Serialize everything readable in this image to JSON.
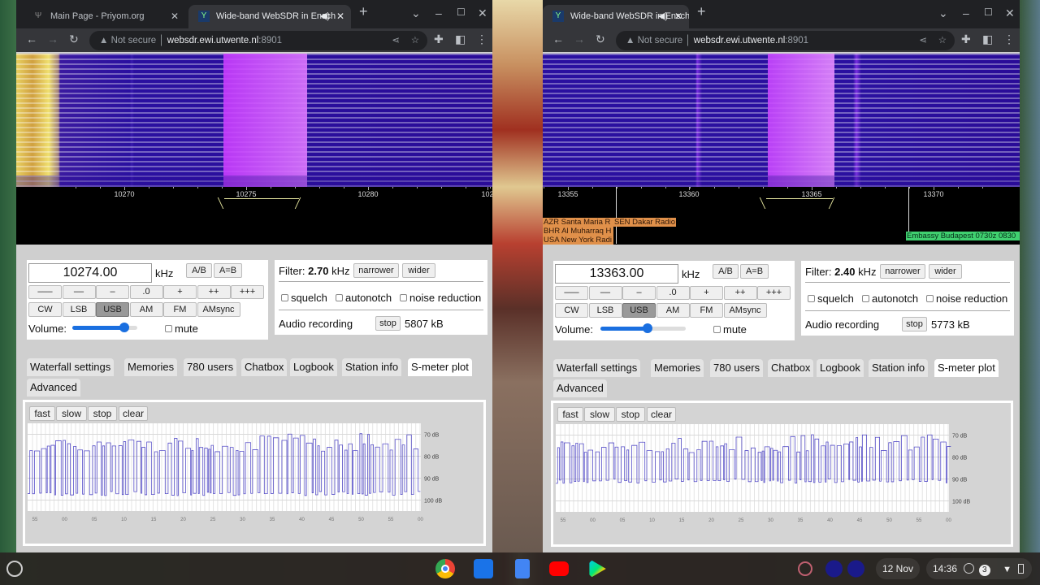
{
  "windows": [
    {
      "tabs": [
        {
          "title": "Main Page - Priyom.org",
          "icon": "priyom-favicon"
        },
        {
          "title": "Wide-band WebSDR in Ensch",
          "icon": "websdr-favicon",
          "audio": true
        }
      ],
      "omnibox": {
        "security": "Not secure",
        "url": "websdr.ewi.utwente.nl",
        "port": ":8901"
      },
      "scale": {
        "ticks": [
          "10270",
          "10275",
          "10280",
          "102"
        ]
      },
      "station_labels": [],
      "frequency": "10274.00",
      "unit": "kHz",
      "ab": "A/B",
      "aeqb": "A=B",
      "steps": [
        "–––",
        "––",
        "–",
        ".0",
        "+",
        "++",
        "+++"
      ],
      "modes": [
        "CW",
        "LSB",
        "USB",
        "AM",
        "FM",
        "AMsync"
      ],
      "active_mode": "USB",
      "volume_label": "Volume:",
      "volume_level": 0.8,
      "mute": "mute",
      "filter_label": "Filter:",
      "filter_value": "2.70",
      "filter_unit": "kHz",
      "narrower": "narrower",
      "wider": "wider",
      "squelch": "squelch",
      "autonotch": "autonotch",
      "noise_reduction": "noise reduction",
      "recording_label": "Audio recording",
      "recording_stop": "stop",
      "recording_size": "5807 kB",
      "panel_tabs": [
        "Waterfall settings",
        "Memories",
        "780 users",
        "Chatbox",
        "Logbook",
        "Station info",
        "S-meter plot",
        "Advanced"
      ],
      "active_panel_tab": "S-meter plot",
      "smeter_buttons": [
        "fast",
        "slow",
        "stop",
        "clear"
      ]
    },
    {
      "tabs": [
        {
          "title": "Wide-band WebSDR in Ensch",
          "icon": "websdr-favicon",
          "audio": true
        }
      ],
      "omnibox": {
        "security": "Not secure",
        "url": "websdr.ewi.utwente.nl",
        "port": ":8901"
      },
      "scale": {
        "ticks": [
          "13355",
          "13360",
          "13365",
          "13370"
        ]
      },
      "station_labels": [
        "AZR Santa Maria R",
        "SEN Dakar Radio",
        "BHR Al Muharraq H",
        "USA New York Radi",
        "Embassy Budapest 0730z 0830"
      ],
      "frequency": "13363.00",
      "unit": "kHz",
      "ab": "A/B",
      "aeqb": "A=B",
      "steps": [
        "–––",
        "––",
        "–",
        ".0",
        "+",
        "++",
        "+++"
      ],
      "modes": [
        "CW",
        "LSB",
        "USB",
        "AM",
        "FM",
        "AMsync"
      ],
      "active_mode": "USB",
      "volume_label": "Volume:",
      "volume_level": 0.55,
      "mute": "mute",
      "filter_label": "Filter:",
      "filter_value": "2.40",
      "filter_unit": "kHz",
      "narrower": "narrower",
      "wider": "wider",
      "squelch": "squelch",
      "autonotch": "autonotch",
      "noise_reduction": "noise reduction",
      "recording_label": "Audio recording",
      "recording_stop": "stop",
      "recording_size": "5773 kB",
      "panel_tabs": [
        "Waterfall settings",
        "Memories",
        "780 users",
        "Chatbox",
        "Logbook",
        "Station info",
        "S-meter plot",
        "Advanced"
      ],
      "active_panel_tab": "S-meter plot",
      "smeter_buttons": [
        "fast",
        "slow",
        "stop",
        "clear"
      ]
    }
  ],
  "chart_data": [
    {
      "type": "line",
      "title": "",
      "y_tick_labels": [
        "70 dB",
        "80 dB",
        "90 dB",
        "100 dB"
      ],
      "ylim": [
        -105,
        -65
      ],
      "x_tick_labels": [
        "55",
        "00",
        "05",
        "10",
        "15",
        "20",
        "25",
        "30",
        "35",
        "40",
        "45",
        "50",
        "55",
        "00"
      ],
      "signal_high_db": [
        -78,
        -68
      ],
      "signal_low_db": -98,
      "color": "#3a30c0"
    },
    {
      "type": "line",
      "title": "",
      "y_tick_labels": [
        "70 dB",
        "80 dB",
        "90 dB",
        "100 dB"
      ],
      "ylim": [
        -105,
        -65
      ],
      "x_tick_labels": [
        "55",
        "00",
        "05",
        "10",
        "15",
        "20",
        "25",
        "30",
        "35",
        "40",
        "45",
        "50",
        "55",
        "00"
      ],
      "signal_high_db": [
        -78,
        -68
      ],
      "signal_low_db": -92,
      "color": "#3a30c0"
    }
  ],
  "taskbar": {
    "apps": [
      "chrome",
      "files",
      "docs",
      "youtube",
      "play-store"
    ],
    "date": "12 Nov",
    "time": "14:36",
    "notifications": "3",
    "colors": {
      "chrome": "#4285f4",
      "youtube": "#ff0000"
    }
  }
}
